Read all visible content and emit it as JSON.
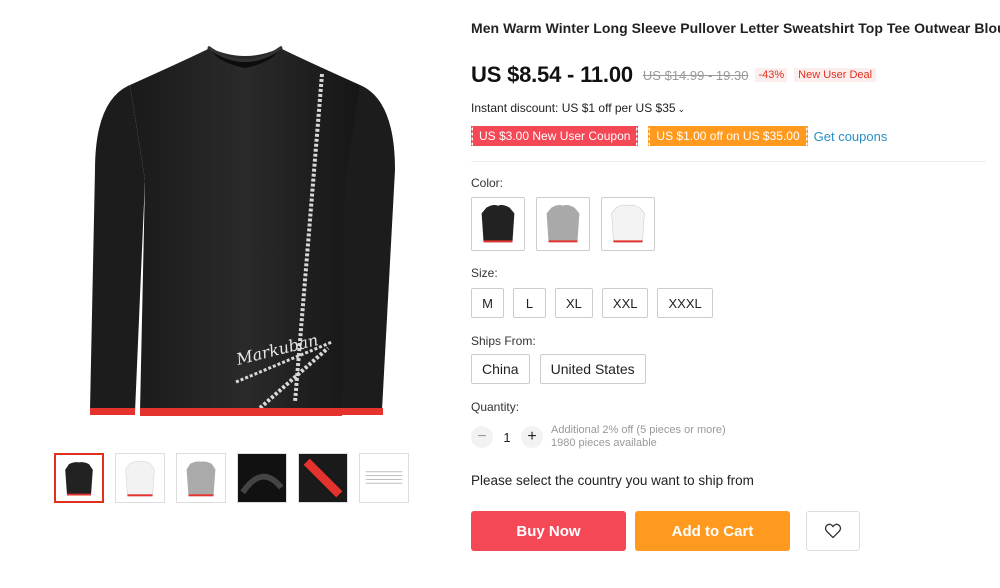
{
  "gallery": {
    "main_image": "black-sweatshirt-image",
    "thumbnails": [
      {
        "name": "black-sweatshirt-thumb",
        "active": true
      },
      {
        "name": "white-sweatshirt-thumb",
        "active": false
      },
      {
        "name": "gray-sweatshirt-thumb",
        "active": false
      },
      {
        "name": "fabric-detail-thumb",
        "active": false
      },
      {
        "name": "red-hem-detail-thumb",
        "active": false
      },
      {
        "name": "size-chart-thumb",
        "active": false
      }
    ]
  },
  "product": {
    "title": "Men Warm Winter Long Sleeve Pullover Letter Sweatshirt Top Tee Outwear Blouse",
    "price": "US $8.54 - 11.00",
    "original_price": "US $14.99 - 19.30",
    "discount": "-43%",
    "deal_badge": "New User Deal",
    "instant_discount": "Instant discount: US $1 off per US $35",
    "coupons": [
      "US $3.00 New User Coupon",
      "US $1.00 off on US $35.00"
    ],
    "get_coupons": "Get coupons",
    "chest_print": "Markuban"
  },
  "options": {
    "color_label": "Color:",
    "colors": [
      "black",
      "gray",
      "white"
    ],
    "size_label": "Size:",
    "sizes": [
      "M",
      "L",
      "XL",
      "XXL",
      "XXXL"
    ],
    "ships_label": "Ships From:",
    "ships_from": [
      "China",
      "United States"
    ],
    "quantity_label": "Quantity:",
    "quantity": "1",
    "qty_note_1": "Additional 2% off (5 pieces or more)",
    "qty_note_2": "1980 pieces available"
  },
  "shipping": {
    "message": "Please select the country you want to ship from"
  },
  "actions": {
    "buy_now": "Buy Now",
    "add_to_cart": "Add to Cart",
    "wishlist_icon": "heart-icon"
  },
  "colors": {
    "brand_red": "#f44857",
    "brand_orange": "#ff9a1f",
    "link_blue": "#2a8fc7",
    "thumb_active_border": "#e0301e"
  }
}
